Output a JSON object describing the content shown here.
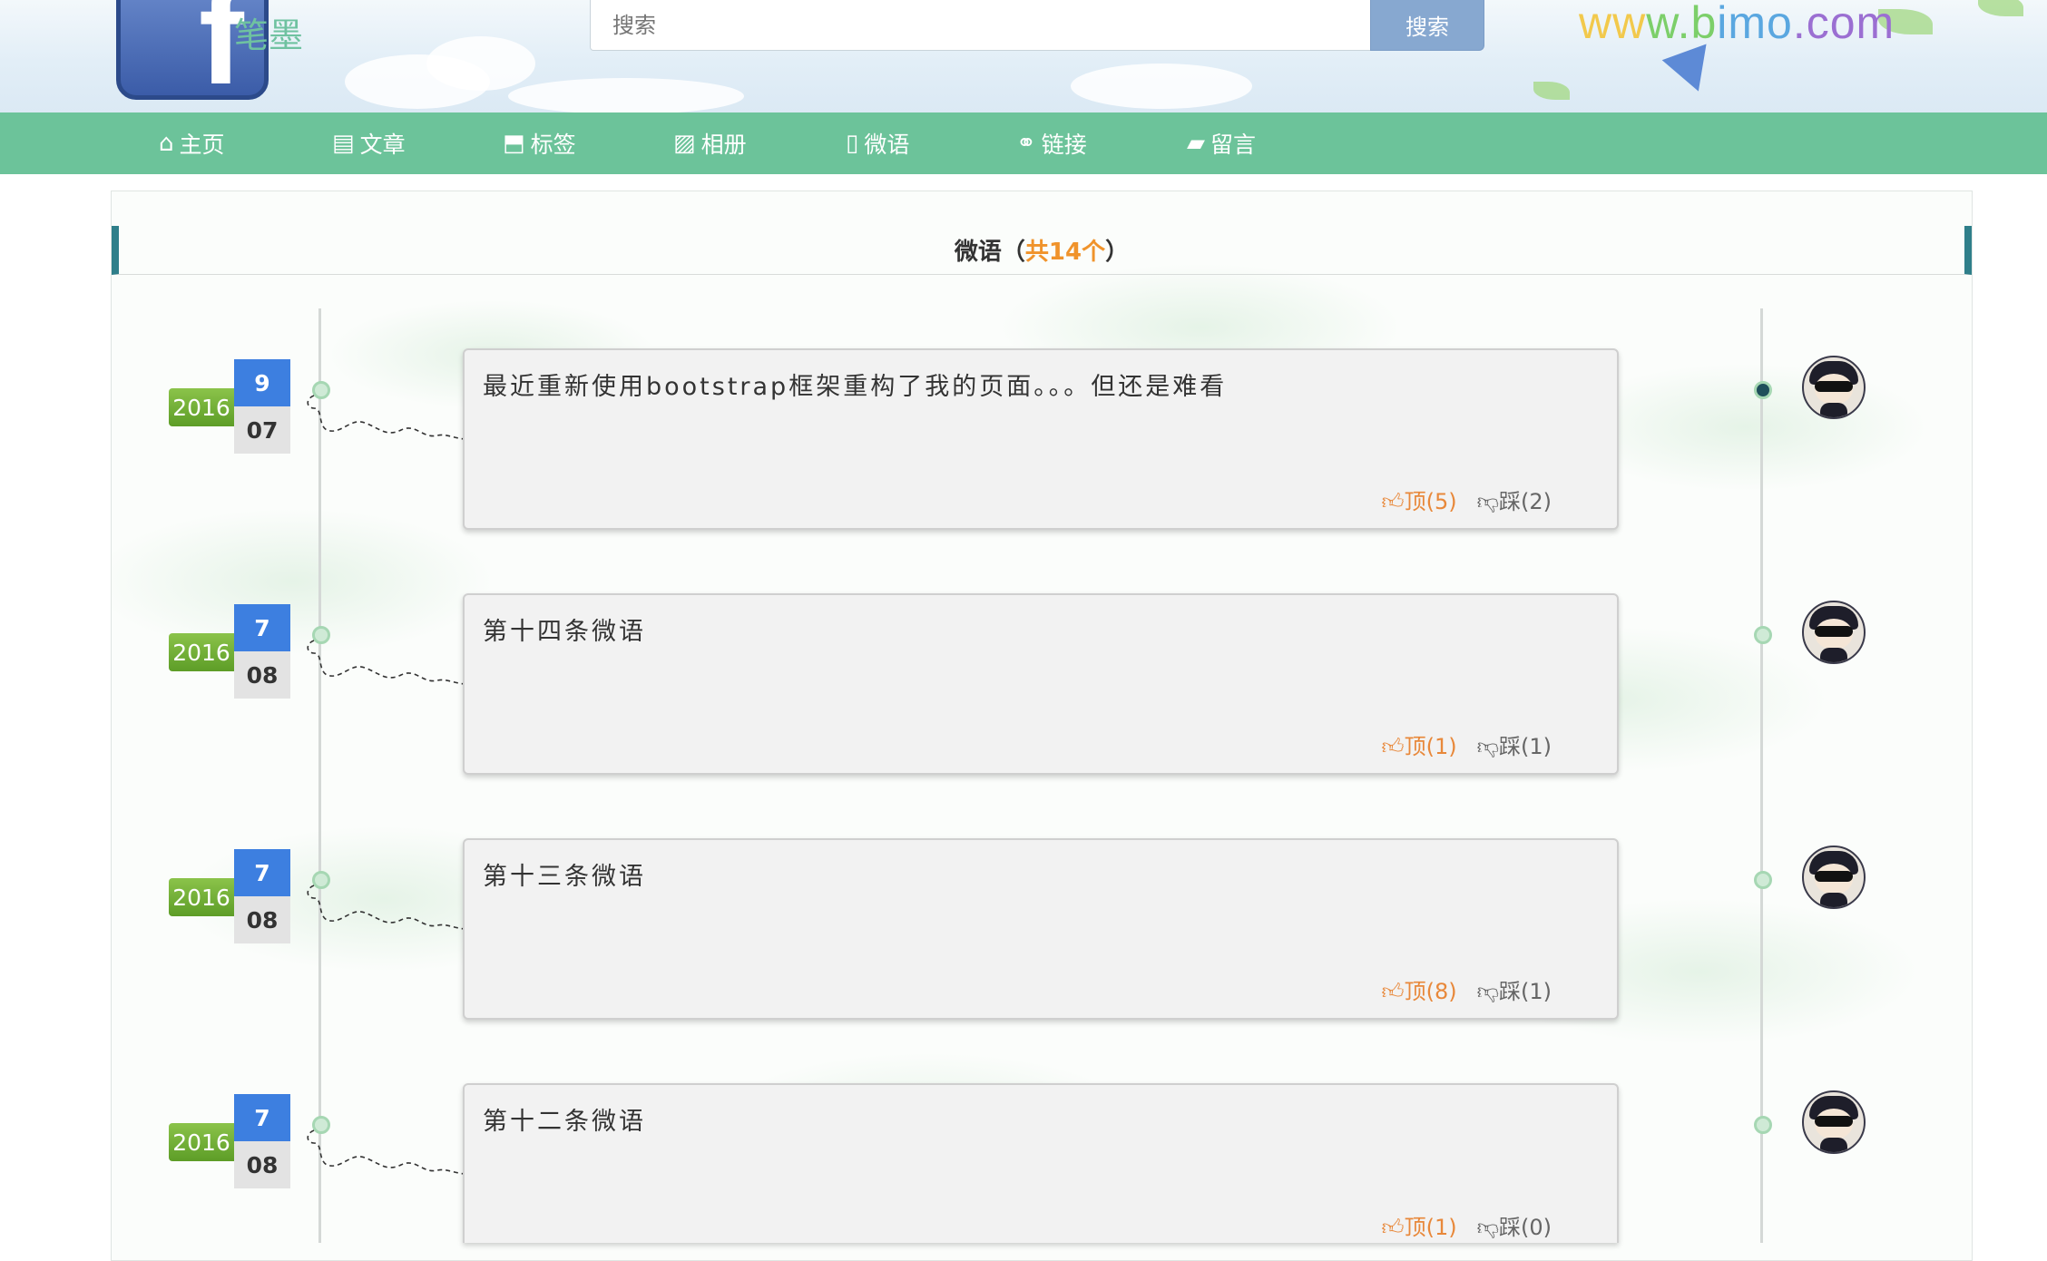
{
  "header": {
    "logo_letter": "f",
    "logo_text": "笔墨",
    "search": {
      "placeholder": "搜索",
      "button_label": "搜索"
    },
    "site_url": {
      "part1": "ww",
      "part2": "w.b",
      "part3": "imo",
      "part4": ".com"
    }
  },
  "nav": {
    "items": [
      {
        "icon": "⌂",
        "label": "主页"
      },
      {
        "icon": "▤",
        "label": "文章"
      },
      {
        "icon": "⬒",
        "label": "标签"
      },
      {
        "icon": "▨",
        "label": "相册"
      },
      {
        "icon": "▯",
        "label": "微语"
      },
      {
        "icon": "⚭",
        "label": "链接"
      },
      {
        "icon": "▰",
        "label": "留言"
      }
    ]
  },
  "panel": {
    "title": "微语",
    "open_paren": "（",
    "count_text": "共14个",
    "close_paren": "）"
  },
  "posts": [
    {
      "year": "2016",
      "month": "9",
      "day": "07",
      "text": "最近重新使用bootstrap框架重构了我的页面。。。但还是难看",
      "up": "顶(5)",
      "down": "踩(2)",
      "active": true
    },
    {
      "year": "2016",
      "month": "7",
      "day": "08",
      "text": "第十四条微语",
      "up": "顶(1)",
      "down": "踩(1)",
      "active": false
    },
    {
      "year": "2016",
      "month": "7",
      "day": "08",
      "text": "第十三条微语",
      "up": "顶(8)",
      "down": "踩(1)",
      "active": false
    },
    {
      "year": "2016",
      "month": "7",
      "day": "08",
      "text": "第十二条微语",
      "up": "顶(1)",
      "down": "踩(0)",
      "active": false
    }
  ],
  "icons": {
    "thumb_up": "thumbs-up-icon",
    "thumb_down": "thumbs-down-icon"
  },
  "colors": {
    "nav_bg": "#6cc39a",
    "accent_orange": "#f0932b",
    "month_blue": "#3d7fe0",
    "year_green": "#6aa92f",
    "title_bar_border": "#2f7f8a"
  }
}
